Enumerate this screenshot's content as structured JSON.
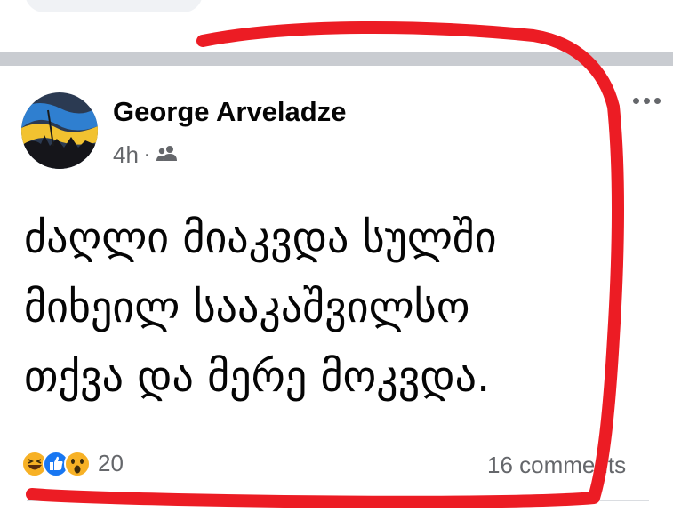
{
  "post": {
    "author": "George Arveladze",
    "time": "4h",
    "separator": "·",
    "audience_icon": "friends-icon",
    "text_lines": [
      "ძაღლი მიაკვდა სულში",
      "მიხეილ სააკაშვილსო",
      "თქვა და მერე მოკვდა."
    ],
    "reactions": {
      "icons": [
        "haha-reaction-icon",
        "like-reaction-icon",
        "wow-reaction-icon"
      ],
      "count": "20"
    },
    "comments": "16 comments"
  },
  "colors": {
    "separator": "#c9ccd1",
    "meta_text": "#65676b",
    "annotation_stroke": "#ec1c24",
    "like_blue": "#1877f2",
    "emoji_yellow": "#f7b125"
  }
}
